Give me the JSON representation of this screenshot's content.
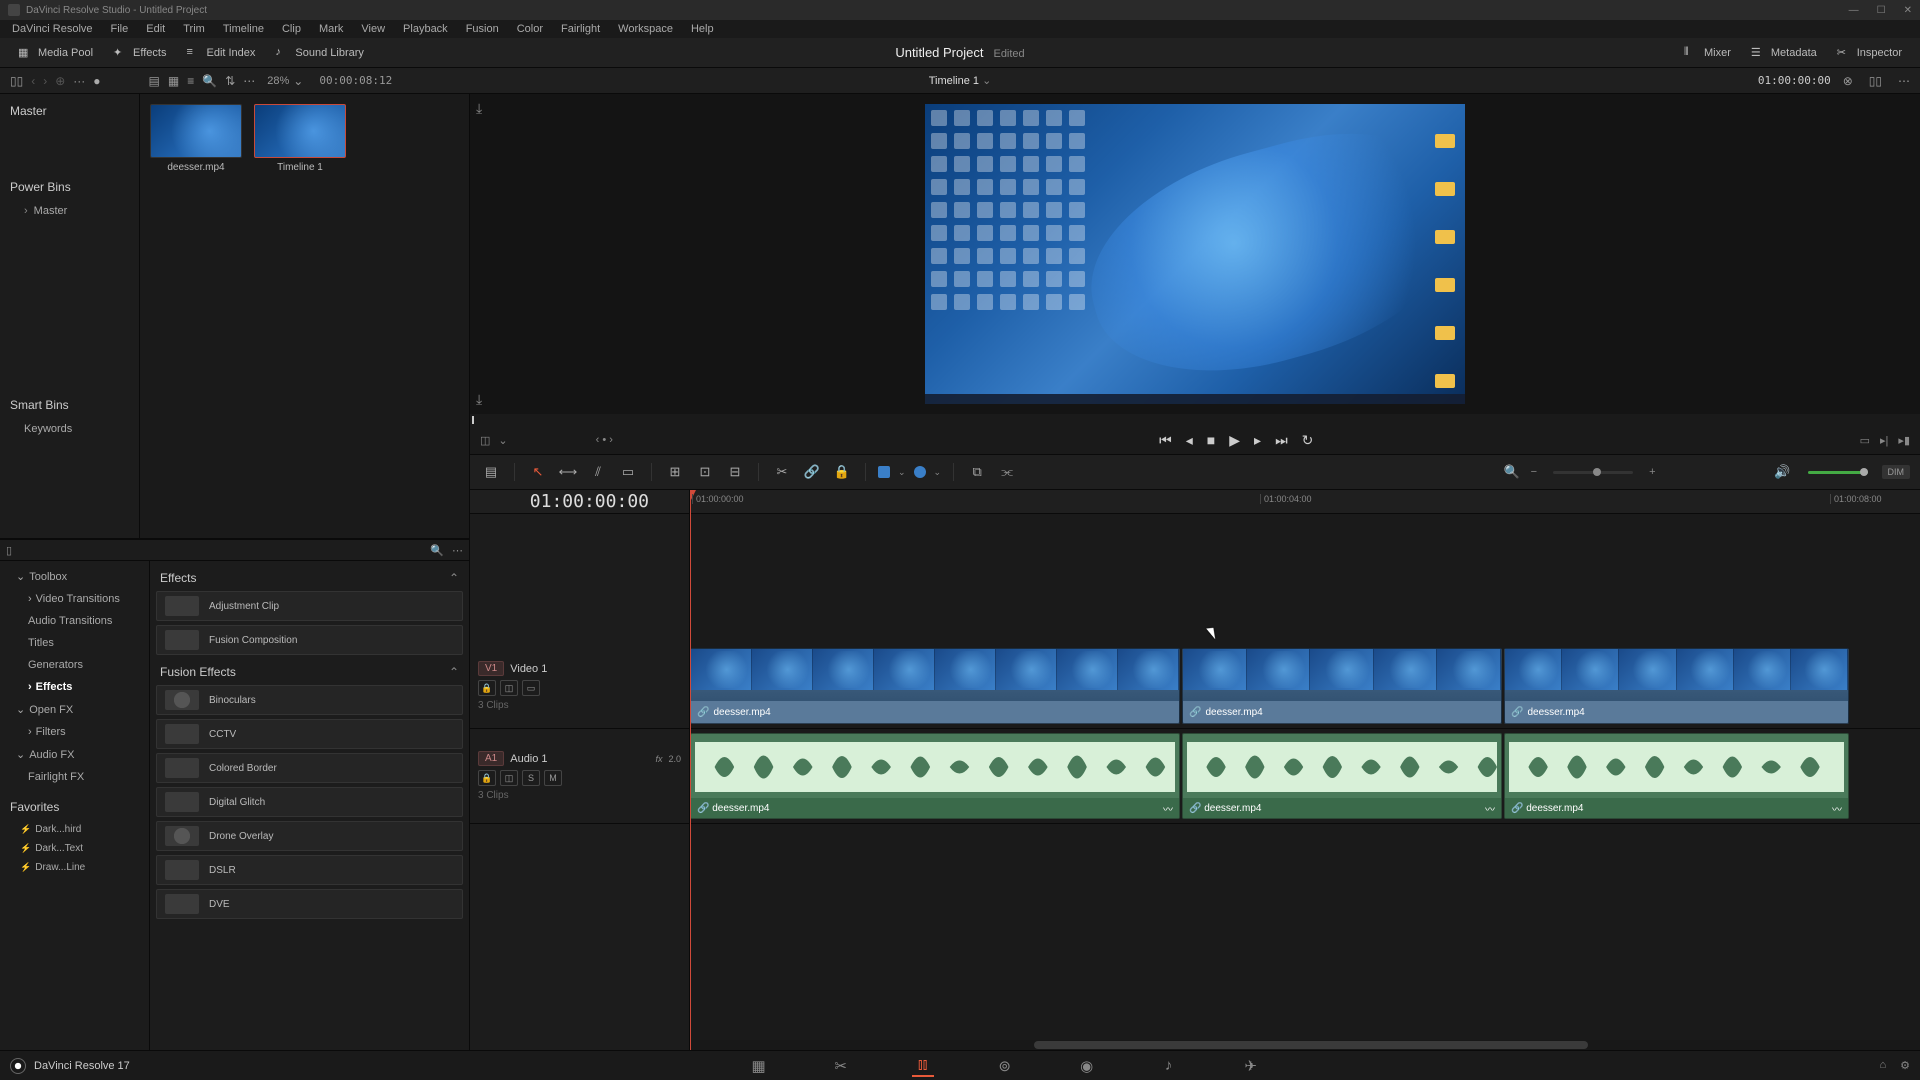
{
  "app": {
    "title": "DaVinci Resolve Studio - Untitled Project"
  },
  "menus": [
    "DaVinci Resolve",
    "File",
    "Edit",
    "Trim",
    "Timeline",
    "Clip",
    "Mark",
    "View",
    "Playback",
    "Fusion",
    "Color",
    "Fairlight",
    "Workspace",
    "Help"
  ],
  "toolbar": {
    "mediaPool": "Media Pool",
    "effects": "Effects",
    "editIndex": "Edit Index",
    "soundLibrary": "Sound Library",
    "mixer": "Mixer",
    "metadata": "Metadata",
    "inspector": "Inspector"
  },
  "project": {
    "title": "Untitled Project",
    "edited": "Edited"
  },
  "subbar": {
    "zoom": "28%",
    "tc": "00:00:08:12",
    "timelineName": "Timeline 1",
    "rightTc": "01:00:00:00"
  },
  "bins": {
    "master": "Master",
    "power": "Power Bins",
    "smart": "Smart Bins",
    "keywords": "Keywords"
  },
  "clips": [
    {
      "name": "deesser.mp4"
    },
    {
      "name": "Timeline 1",
      "selected": true
    }
  ],
  "effectsTree": {
    "toolbox": "Toolbox",
    "videoTransitions": "Video Transitions",
    "audioTransitions": "Audio Transitions",
    "titles": "Titles",
    "generators": "Generators",
    "effects": "Effects",
    "openfx": "Open FX",
    "filters": "Filters",
    "audiofx": "Audio FX",
    "fairlightfx": "Fairlight FX",
    "favorites": "Favorites",
    "favItems": [
      "Dark...hird",
      "Dark...Text",
      "Draw...Line"
    ]
  },
  "effectsList": {
    "sectionEffects": "Effects",
    "sectionFusion": "Fusion Effects",
    "items1": [
      "Adjustment Clip",
      "Fusion Composition"
    ],
    "items2": [
      "Binoculars",
      "CCTV",
      "Colored Border",
      "Digital Glitch",
      "Drone Overlay",
      "DSLR",
      "DVE"
    ]
  },
  "timeline": {
    "tc": "01:00:00:00",
    "rulerTicks": [
      "01:00:00:00",
      "01:00:04:00",
      "01:00:08:00"
    ],
    "videoTrack": {
      "id": "V1",
      "name": "Video 1",
      "info": "3 Clips"
    },
    "audioTrack": {
      "id": "A1",
      "name": "Audio 1",
      "info": "3 Clips",
      "fx": "fx",
      "ch": "2.0"
    },
    "clipName": "deesser.mp4"
  },
  "bottom": {
    "app": "DaVinci Resolve 17"
  },
  "dim": "DIM"
}
